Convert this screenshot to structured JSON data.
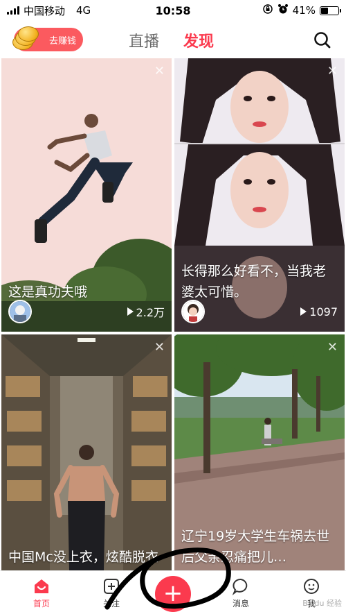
{
  "status_bar": {
    "carrier": "中国移动",
    "network": "4G",
    "time": "10:58",
    "battery": "41%",
    "battery_level": 0.41
  },
  "top_nav": {
    "earn_label": "去赚钱",
    "tab_live": "直播",
    "tab_discover": "发现"
  },
  "cards": [
    {
      "caption": "这是真功夫哦",
      "views": "2.2万"
    },
    {
      "caption": "长得那么好看不，当我老婆太可惜。",
      "views": "1097"
    },
    {
      "caption": "中国Mc没上衣，炫酷脱衣",
      "views": ""
    },
    {
      "caption": "辽宁19岁大学生车祸去世后父亲忍痛把儿…",
      "views": ""
    }
  ],
  "bottom_nav": {
    "home": "首页",
    "follow": "关注",
    "post": "+",
    "messages": "消息",
    "me": "我"
  },
  "watermark": "Baidu 经验",
  "accent_color": "#fb3a4e"
}
